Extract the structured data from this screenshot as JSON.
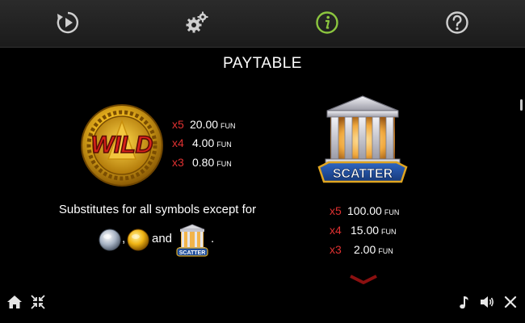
{
  "toolbar": {
    "items": [
      {
        "name": "autoplay",
        "icon": "replay-play-icon"
      },
      {
        "name": "settings",
        "icon": "gears-icon"
      },
      {
        "name": "info",
        "icon": "info-icon",
        "active": true
      },
      {
        "name": "help",
        "icon": "question-icon"
      }
    ],
    "active_color": "#8cc63f"
  },
  "paytable": {
    "title": "PAYTABLE",
    "wild": {
      "symbol_text": "WILD",
      "pays": [
        {
          "mult": "x5",
          "amount": "20.00",
          "currency": "FUN"
        },
        {
          "mult": "x4",
          "amount": "4.00",
          "currency": "FUN"
        },
        {
          "mult": "x3",
          "amount": "0.80",
          "currency": "FUN"
        }
      ],
      "description": "Substitutes for all symbols except for",
      "exceptions": {
        "comma": ",",
        "and": "and",
        "period": ".",
        "scatter_mini_text": "SCATTER"
      }
    },
    "scatter": {
      "symbol_text": "SCATTER",
      "pays": [
        {
          "mult": "x5",
          "amount": "100.00",
          "currency": "FUN"
        },
        {
          "mult": "x4",
          "amount": "15.00",
          "currency": "FUN"
        },
        {
          "mult": "x3",
          "amount": "2.00",
          "currency": "FUN"
        }
      ]
    }
  },
  "bottom_bar": {
    "left": [
      {
        "name": "home",
        "icon": "home-icon"
      },
      {
        "name": "fullscreen",
        "icon": "compress-icon"
      }
    ],
    "right": [
      {
        "name": "music",
        "icon": "music-note-icon"
      },
      {
        "name": "sound",
        "icon": "speaker-icon"
      },
      {
        "name": "close",
        "icon": "close-icon"
      }
    ]
  },
  "colors": {
    "multiplier": "#e03131",
    "gold": "#e0a21a",
    "scatter_banner": "#1f4e9c"
  }
}
